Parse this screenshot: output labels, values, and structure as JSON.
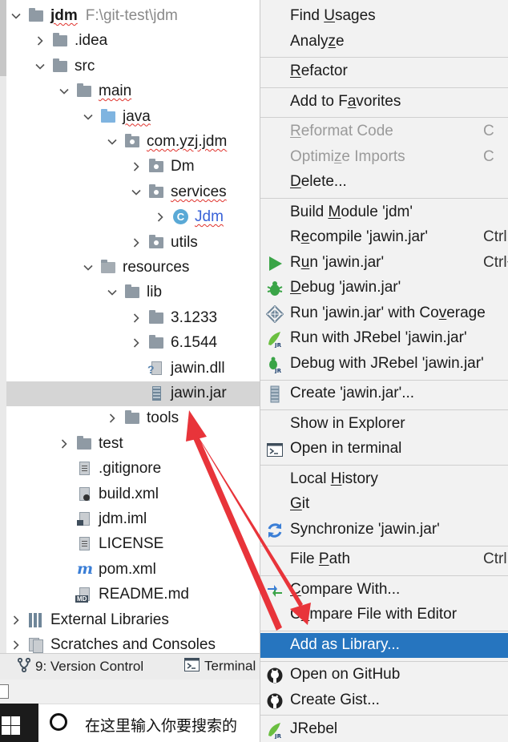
{
  "tree": {
    "items": [
      {
        "label": "jdm",
        "path": "F:\\git-test\\jdm",
        "depth": 0,
        "expanded": true,
        "icon": "folder-icon",
        "bold": true,
        "squiggle": true
      },
      {
        "label": ".idea",
        "depth": 1,
        "expanded": false,
        "icon": "folder-icon"
      },
      {
        "label": "src",
        "depth": 1,
        "expanded": true,
        "icon": "folder-icon"
      },
      {
        "label": "main",
        "depth": 2,
        "expanded": true,
        "icon": "folder-icon",
        "squiggle": true
      },
      {
        "label": "java",
        "depth": 3,
        "expanded": true,
        "icon": "source-folder-icon",
        "squiggle": true
      },
      {
        "label": "com.yzj.jdm",
        "depth": 4,
        "expanded": true,
        "icon": "package-icon",
        "squiggle": true
      },
      {
        "label": "Dm",
        "depth": 5,
        "expanded": false,
        "icon": "package-icon"
      },
      {
        "label": "services",
        "depth": 5,
        "expanded": true,
        "icon": "package-icon",
        "squiggle": true
      },
      {
        "label": "Jdm",
        "depth": 6,
        "expanded": false,
        "icon": "class-icon",
        "blue": true,
        "squiggle": true
      },
      {
        "label": "utils",
        "depth": 5,
        "expanded": false,
        "icon": "package-icon"
      },
      {
        "label": "resources",
        "depth": 3,
        "expanded": true,
        "icon": "resources-folder-icon"
      },
      {
        "label": "lib",
        "depth": 4,
        "expanded": true,
        "icon": "folder-icon"
      },
      {
        "label": "3.1233",
        "depth": 5,
        "expanded": false,
        "icon": "folder-icon"
      },
      {
        "label": "6.1544",
        "depth": 5,
        "expanded": false,
        "icon": "folder-icon"
      },
      {
        "label": "jawin.dll",
        "depth": 5,
        "leaf": true,
        "icon": "unknown-file-icon"
      },
      {
        "label": "jawin.jar",
        "depth": 5,
        "leaf": true,
        "icon": "jar-file-icon",
        "selected": true
      },
      {
        "label": "tools",
        "depth": 4,
        "expanded": false,
        "icon": "folder-icon"
      },
      {
        "label": "test",
        "depth": 2,
        "expanded": false,
        "icon": "folder-icon"
      },
      {
        "label": ".gitignore",
        "depth": 2,
        "leaf": true,
        "icon": "text-file-icon"
      },
      {
        "label": "build.xml",
        "depth": 2,
        "leaf": true,
        "icon": "ant-file-icon"
      },
      {
        "label": "jdm.iml",
        "depth": 2,
        "leaf": true,
        "icon": "module-file-icon"
      },
      {
        "label": "LICENSE",
        "depth": 2,
        "leaf": true,
        "icon": "text-file-icon"
      },
      {
        "label": "pom.xml",
        "depth": 2,
        "leaf": true,
        "icon": "maven-icon"
      },
      {
        "label": "README.md",
        "depth": 2,
        "leaf": true,
        "icon": "markdown-icon"
      },
      {
        "label": "External Libraries",
        "depth": 0,
        "expanded": false,
        "icon": "libraries-icon"
      },
      {
        "label": "Scratches and Consoles",
        "depth": 0,
        "expanded": false,
        "icon": "scratches-icon"
      }
    ]
  },
  "toolstrip": {
    "version_control": "9: Version Control",
    "terminal": "Terminal"
  },
  "taskbar": {
    "search_placeholder": "在这里输入你要搜索的"
  },
  "menu": {
    "items": [
      {
        "label": "Find Usages",
        "mn": "U",
        "shortcut": "",
        "icon": ""
      },
      {
        "label": "Analyze",
        "mn": "z",
        "shortcut": "",
        "icon": "",
        "sep_after": true
      },
      {
        "label": "Refactor",
        "mn": "R",
        "shortcut": "",
        "icon": "",
        "sep_after": true
      },
      {
        "label": "Add to Favorites",
        "mn": "a",
        "shortcut": "",
        "icon": "",
        "sep_after": true
      },
      {
        "label": "Reformat Code",
        "mn": "R",
        "shortcut": "C",
        "icon": "",
        "disabled": true
      },
      {
        "label": "Optimize Imports",
        "mn": "z",
        "shortcut": "C",
        "icon": "",
        "disabled": true
      },
      {
        "label": "Delete...",
        "mn": "D",
        "shortcut": "",
        "icon": "",
        "sep_after": true
      },
      {
        "label": "Build Module 'jdm'",
        "mn": "M",
        "shortcut": "",
        "icon": ""
      },
      {
        "label": "Recompile 'jawin.jar'",
        "mn": "e",
        "shortcut": "Ctrl",
        "icon": ""
      },
      {
        "label": "Run 'jawin.jar'",
        "mn": "u",
        "shortcut": "Ctrl+",
        "icon": "run-icon"
      },
      {
        "label": "Debug 'jawin.jar'",
        "mn": "D",
        "shortcut": "",
        "icon": "debug-icon"
      },
      {
        "label": "Run 'jawin.jar' with Coverage",
        "mn": "v",
        "shortcut": "",
        "icon": "coverage-icon"
      },
      {
        "label": "Run with JRebel 'jawin.jar'",
        "mn": "",
        "shortcut": "",
        "icon": "jrebel-run-icon"
      },
      {
        "label": "Debug with JRebel 'jawin.jar'",
        "mn": "",
        "shortcut": "",
        "icon": "jrebel-debug-icon",
        "sep_after": true
      },
      {
        "label": "Create 'jawin.jar'...",
        "mn": "",
        "shortcut": "",
        "icon": "jar-config-icon",
        "sep_after": true
      },
      {
        "label": "Show in Explorer",
        "mn": "",
        "shortcut": "",
        "icon": ""
      },
      {
        "label": "Open in terminal",
        "mn": "",
        "shortcut": "",
        "icon": "terminal-icon",
        "sep_after": true
      },
      {
        "label": "Local History",
        "mn": "H",
        "shortcut": "",
        "icon": ""
      },
      {
        "label": "Git",
        "mn": "G",
        "shortcut": "",
        "icon": ""
      },
      {
        "label": "Synchronize 'jawin.jar'",
        "mn": "",
        "shortcut": "",
        "icon": "sync-icon",
        "sep_after": true
      },
      {
        "label": "File Path",
        "mn": "P",
        "shortcut": "Ctrl",
        "icon": "",
        "sep_after": true
      },
      {
        "label": "Compare With...",
        "mn": "C",
        "shortcut": "",
        "icon": "compare-icon"
      },
      {
        "label": "Compare File with Editor",
        "mn": "o",
        "shortcut": "",
        "icon": "",
        "sep_after": true
      },
      {
        "label": "Add as Library...",
        "mn": "",
        "shortcut": "",
        "icon": "",
        "highlighted": true,
        "sep_after": true
      },
      {
        "label": "Open on GitHub",
        "mn": "",
        "shortcut": "",
        "icon": "github-icon"
      },
      {
        "label": "Create Gist...",
        "mn": "",
        "shortcut": "",
        "icon": "github-icon",
        "sep_after": true
      },
      {
        "label": "JRebel",
        "mn": "",
        "shortcut": "",
        "icon": "jrebel-icon"
      }
    ]
  },
  "colors": {
    "selection_bg": "#d5d5d5",
    "menu_highlight": "#2675bf",
    "annotation_arrow": "#e8343a",
    "error_squiggle": "#e0322c"
  }
}
